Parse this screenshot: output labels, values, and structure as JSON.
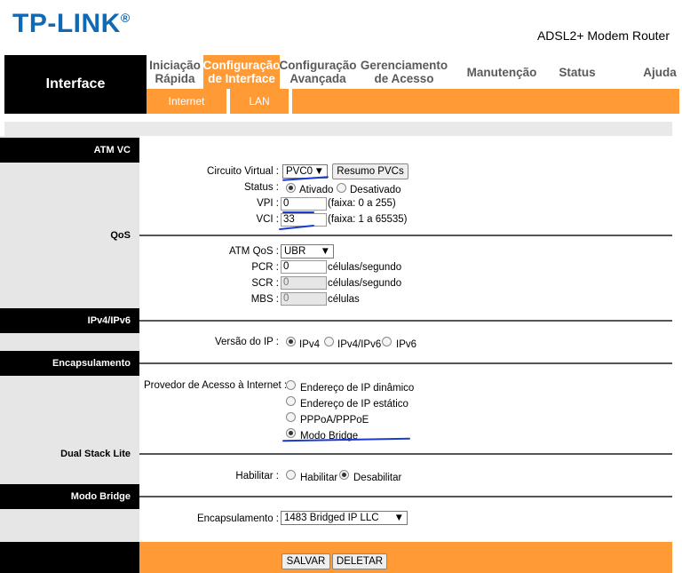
{
  "brand": {
    "logo": "TP-LINK",
    "reg": "®",
    "model": "ADSL2+ Modem Router"
  },
  "nav": {
    "title": "Interface",
    "tabs": [
      {
        "line1": "Iniciação",
        "line2": "Rápida"
      },
      {
        "line1": "Configuração",
        "line2": "de Interface"
      },
      {
        "line1": "Configuração",
        "line2": "Avançada"
      },
      {
        "line1": "Gerenciamento",
        "line2": "de Acesso"
      },
      {
        "line1": "Manutenção",
        "line2": ""
      },
      {
        "line1": "Status",
        "line2": ""
      },
      {
        "line1": "Ajuda",
        "line2": ""
      }
    ],
    "subtabs": [
      "Internet",
      "LAN"
    ]
  },
  "sections": {
    "atm_vc": "ATM VC",
    "qos": "QoS",
    "ipv": "IPv4/IPv6",
    "encap": "Encapsulamento",
    "dslite": "Dual Stack Lite",
    "bridge": "Modo Bridge"
  },
  "atm": {
    "circuit_label": "Circuito Virtual :",
    "circuit_value": "PVC0",
    "summary_button": "Resumo PVCs",
    "status_label": "Status :",
    "status_on": "Ativado",
    "status_off": "Desativado",
    "vpi_label": "VPI :",
    "vpi_value": "0",
    "vpi_range": "(faixa: 0 a 255)",
    "vci_label": "VCI :",
    "vci_value": "33",
    "vci_range": "(faixa: 1 a 65535)"
  },
  "qos": {
    "atmqos_label": "ATM QoS :",
    "atmqos_value": "UBR",
    "pcr_label": "PCR :",
    "pcr_value": "0",
    "scr_label": "SCR :",
    "scr_value": "0",
    "mbs_label": "MBS :",
    "mbs_value": "0",
    "unit_cells_sec": "células/segundo",
    "unit_cells": "células"
  },
  "ip": {
    "version_label": "Versão do IP :",
    "opt_v4": "IPv4",
    "opt_v4v6": "IPv4/IPv6",
    "opt_v6": "IPv6"
  },
  "isp": {
    "label": "Provedor de Acesso à Internet :",
    "opts": [
      "Endereço de IP dinâmico",
      "Endereço de IP estático",
      "PPPoA/PPPoE",
      "Modo Bridge"
    ]
  },
  "dslite": {
    "label": "Habilitar :",
    "opt_on": "Habilitar",
    "opt_off": "Desabilitar"
  },
  "bridge": {
    "label": "Encapsulamento :",
    "value": "1483 Bridged IP LLC"
  },
  "footer": {
    "save": "SALVAR",
    "delete": "DELETAR"
  }
}
